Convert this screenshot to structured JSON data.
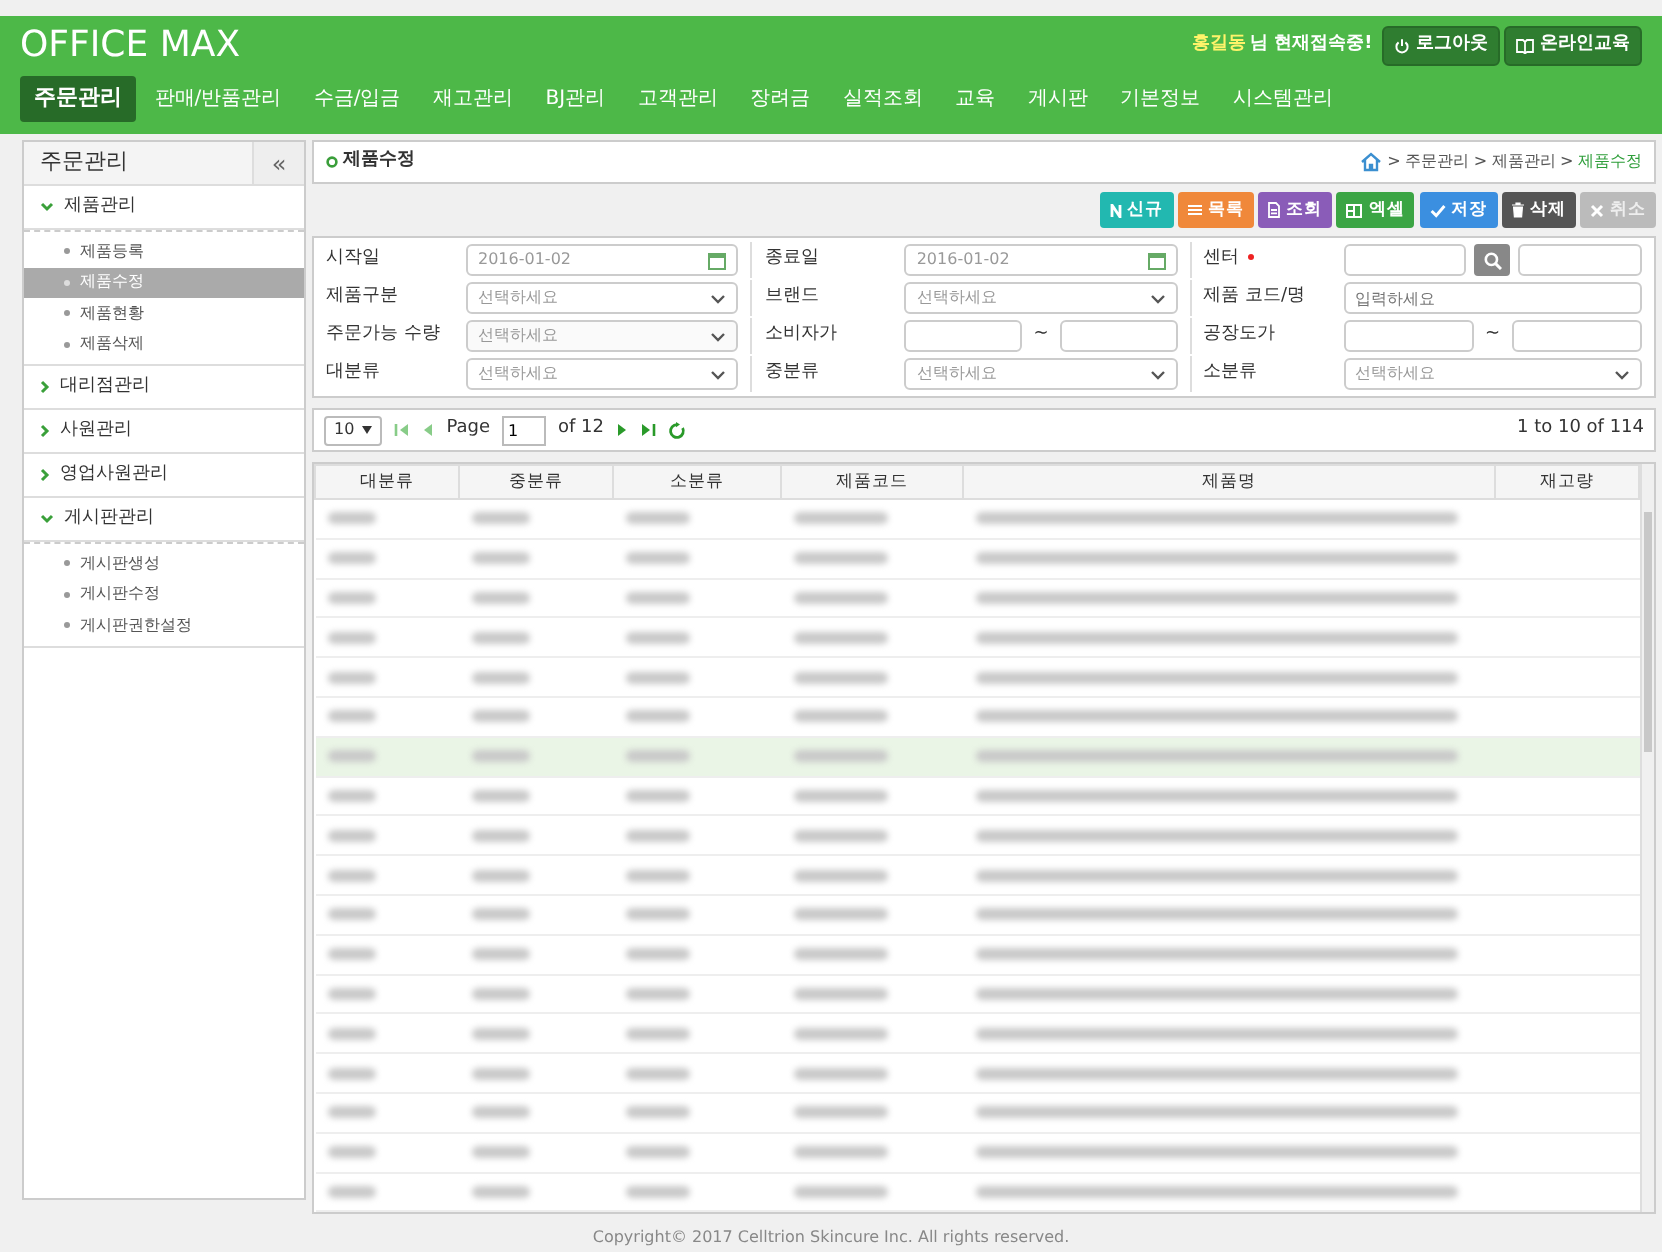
{
  "header": {
    "title": "OFFICE MAX",
    "user_name": "홍길동",
    "user_suffix": "님 현재접속중!",
    "buttons": [
      {
        "kind": "power",
        "label": "로그아웃"
      },
      {
        "kind": "book",
        "label": "온라인교육"
      }
    ]
  },
  "menu": [
    {
      "label": "주문관리",
      "selected": true
    },
    {
      "label": "판매/반품관리",
      "selected": false
    },
    {
      "label": "수금/입금",
      "selected": false
    },
    {
      "label": "재고관리",
      "selected": false
    },
    {
      "label": "BJ관리",
      "selected": false
    },
    {
      "label": "고객관리",
      "selected": false
    },
    {
      "label": "장려금",
      "selected": false
    },
    {
      "label": "실적조회",
      "selected": false
    },
    {
      "label": "교육",
      "selected": false
    },
    {
      "label": "게시판",
      "selected": false
    },
    {
      "label": "기본정보",
      "selected": false
    },
    {
      "label": "시스템관리",
      "selected": false
    }
  ],
  "sidebar": {
    "title": "주문관리",
    "collapse": "«",
    "items": [
      {
        "label": "제품관리",
        "expanded": true,
        "children": [
          {
            "label": "제품등록",
            "selected": false
          },
          {
            "label": "제품수정",
            "selected": true
          },
          {
            "label": "제품현황",
            "selected": false
          },
          {
            "label": "제품삭제",
            "selected": false
          }
        ]
      },
      {
        "label": "대리점관리",
        "expanded": false
      },
      {
        "label": "사원관리",
        "expanded": false
      },
      {
        "label": "영업사원관리",
        "expanded": false
      },
      {
        "label": "게시판관리",
        "expanded": true,
        "children": [
          {
            "label": "게시판생성",
            "selected": false
          },
          {
            "label": "게시판수정",
            "selected": false
          },
          {
            "label": "게시판권한설정",
            "selected": false
          }
        ]
      }
    ]
  },
  "page_title": "제품수정",
  "breadcrumb": [
    "주문관리",
    "제품관리",
    "제품수정"
  ],
  "breadcrumb_separator": ">",
  "toolbar": [
    {
      "kind": "new",
      "label": "신규",
      "color": "#22b8b0",
      "disabled": false
    },
    {
      "kind": "list",
      "label": "목록",
      "color": "#f0883a",
      "disabled": false
    },
    {
      "kind": "search",
      "label": "조회",
      "color": "#8a5cb8",
      "disabled": false
    },
    {
      "kind": "excel",
      "label": "엑셀",
      "color": "#3ba544",
      "disabled": false
    },
    {
      "kind": "save",
      "label": "저장",
      "color": "#3b8fe0",
      "disabled": false
    },
    {
      "kind": "delete",
      "label": "삭제",
      "color": "#555555",
      "disabled": false
    },
    {
      "kind": "cancel",
      "label": "취소",
      "color": "#bbbbbb",
      "disabled": true
    }
  ],
  "form": [
    {
      "label": "시작일",
      "kind": "date",
      "value": "2016-01-02"
    },
    {
      "label": "종료일",
      "kind": "date",
      "value": "2016-01-02"
    },
    {
      "label": "센터",
      "kind": "lookup",
      "required": true
    },
    {
      "label": "제품구분",
      "kind": "select",
      "placeholder": "선택하세요"
    },
    {
      "label": "브랜드",
      "kind": "select",
      "placeholder": "선택하세요"
    },
    {
      "label": "제품 코드/명",
      "kind": "text",
      "placeholder": "입력하세요"
    },
    {
      "label": "주문가능 수량",
      "kind": "select",
      "placeholder": "선택하세요",
      "disabled": true
    },
    {
      "label": "소비자가",
      "kind": "range",
      "separator": "~"
    },
    {
      "label": "공장도가",
      "kind": "range",
      "separator": "~"
    },
    {
      "label": "대분류",
      "kind": "select",
      "placeholder": "선택하세요"
    },
    {
      "label": "중분류",
      "kind": "select",
      "placeholder": "선택하세요"
    },
    {
      "label": "소분류",
      "kind": "select",
      "placeholder": "선택하세요"
    }
  ],
  "pager": {
    "page_size": "10",
    "page_label": "Page",
    "page": "1",
    "of": "of 12",
    "summary": "1 to 10 of 114"
  },
  "table": {
    "columns": [
      "대분류",
      "중분류",
      "소분류",
      "제품코드",
      "제품명",
      "재고량"
    ],
    "rows": [
      {
        "selected": false
      },
      {
        "selected": false
      },
      {
        "selected": false
      },
      {
        "selected": false
      },
      {
        "selected": false
      },
      {
        "selected": false
      },
      {
        "selected": true
      },
      {
        "selected": false
      },
      {
        "selected": false
      },
      {
        "selected": false
      },
      {
        "selected": false
      },
      {
        "selected": false
      },
      {
        "selected": false
      },
      {
        "selected": false
      },
      {
        "selected": false
      },
      {
        "selected": false
      },
      {
        "selected": false
      },
      {
        "selected": false
      }
    ]
  },
  "footer": "Copyright© 2017 Celltrion Skincure Inc. All rights reserved."
}
